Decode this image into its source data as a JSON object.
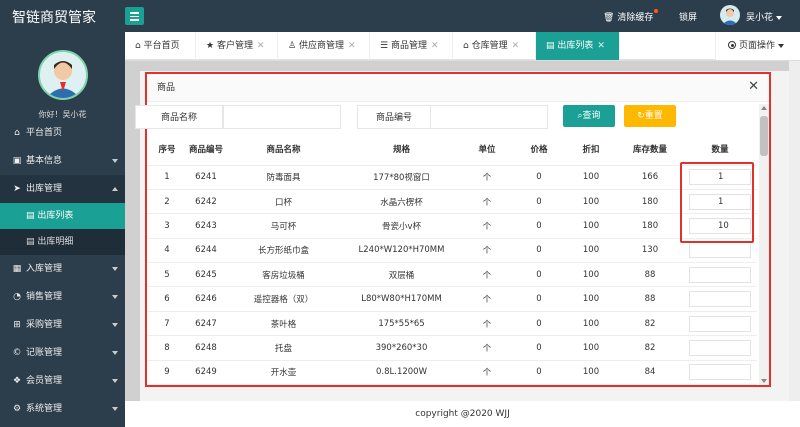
{
  "app": {
    "brand": "智链商贸管家"
  },
  "topbar": {
    "clear_cache": "清除缓存",
    "lock": "锁屏",
    "user": "吴小花"
  },
  "sidebar": {
    "greeting": "你好！吴小花",
    "items": [
      {
        "label": "平台首页",
        "icon": "home-icon"
      },
      {
        "label": "基本信息",
        "icon": "info-icon"
      },
      {
        "label": "出库管理",
        "icon": "send-icon"
      },
      {
        "label": "入库管理",
        "icon": "import-icon"
      },
      {
        "label": "销售管理",
        "icon": "chart-icon"
      },
      {
        "label": "采购管理",
        "icon": "cart-icon"
      },
      {
        "label": "记账管理",
        "icon": "copyright-icon"
      },
      {
        "label": "会员管理",
        "icon": "cube-icon"
      },
      {
        "label": "系统管理",
        "icon": "gear-icon"
      }
    ],
    "sub_items": [
      {
        "label": "出库列表"
      },
      {
        "label": "出库明细"
      }
    ]
  },
  "tabs": [
    {
      "label": "平台首页"
    },
    {
      "label": "客户管理"
    },
    {
      "label": "供应商管理"
    },
    {
      "label": "商品管理"
    },
    {
      "label": "仓库管理"
    },
    {
      "label": "出库列表"
    }
  ],
  "page_ops": "页面操作",
  "modal": {
    "title": "商品",
    "search": {
      "name_label": "商品名称",
      "name_value": "",
      "code_label": "商品编号",
      "code_value": "",
      "query_button": "查询",
      "reset_button": "重置"
    },
    "columns": [
      "序号",
      "商品编号",
      "商品名称",
      "规格",
      "单位",
      "价格",
      "折扣",
      "库存数量",
      "数量"
    ],
    "rows": [
      [
        "1",
        "6241",
        "防毒面具",
        "177*80视窗口",
        "个",
        "0",
        "100",
        "166",
        "1"
      ],
      [
        "2",
        "6242",
        "口杯",
        "水晶六楞杯",
        "个",
        "0",
        "100",
        "180",
        "1"
      ],
      [
        "3",
        "6243",
        "马可杯",
        "骨瓷小v杯",
        "个",
        "0",
        "100",
        "180",
        "10"
      ],
      [
        "4",
        "6244",
        "长方形纸巾盒",
        "L240*W120*H70MM",
        "个",
        "0",
        "100",
        "130",
        ""
      ],
      [
        "5",
        "6245",
        "客房垃圾桶",
        "双层桶",
        "个",
        "0",
        "100",
        "88",
        ""
      ],
      [
        "6",
        "6246",
        "遥控器格（双）",
        "L80*W80*H170MM",
        "个",
        "0",
        "100",
        "88",
        ""
      ],
      [
        "7",
        "6247",
        "茶叶格",
        "175*55*65",
        "个",
        "0",
        "100",
        "82",
        ""
      ],
      [
        "8",
        "6248",
        "托盘",
        "390*260*30",
        "个",
        "0",
        "100",
        "82",
        ""
      ],
      [
        "9",
        "6249",
        "开水壶",
        "0.8L.1200W",
        "个",
        "0",
        "100",
        "84",
        ""
      ]
    ]
  },
  "footer": {
    "copyright": "copyright @2020 WJJ"
  }
}
